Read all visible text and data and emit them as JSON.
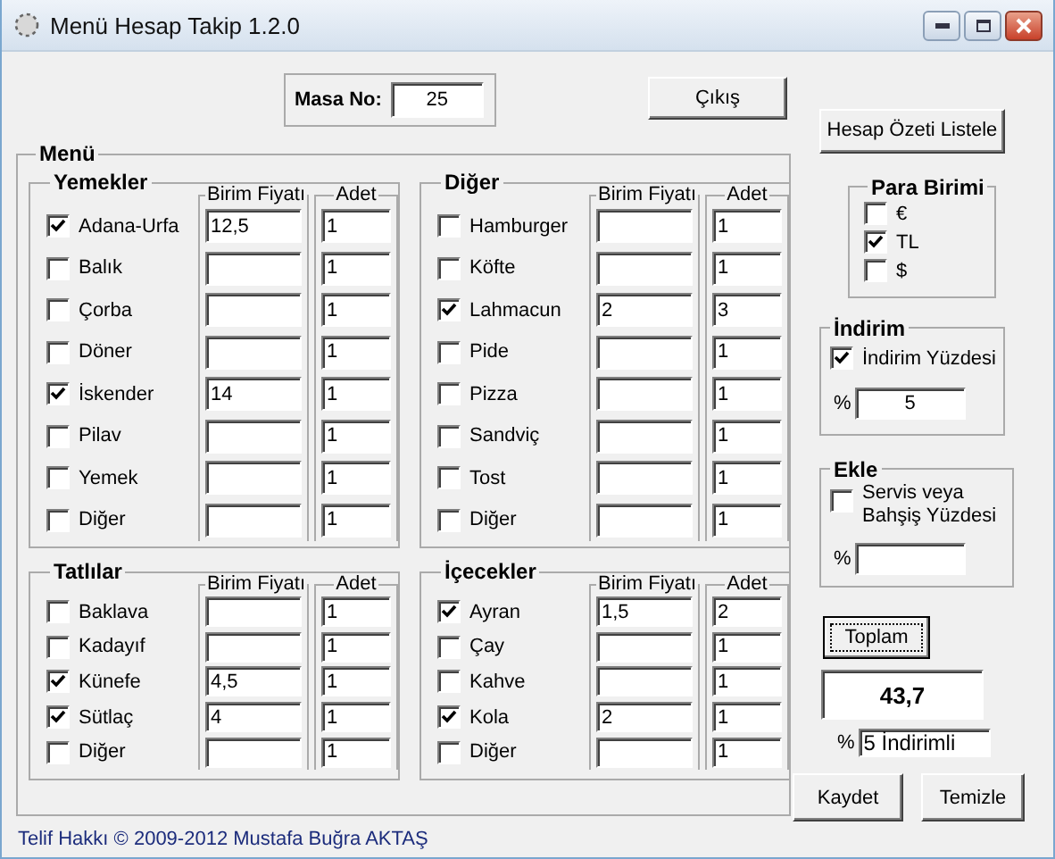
{
  "window": {
    "title": "Menü Hesap Takip 1.2.0"
  },
  "table_no": {
    "label": "Masa No:",
    "value": "25"
  },
  "exit_button": "Çıkış",
  "menu": {
    "title": "Menü",
    "groups": [
      {
        "title": "Yemekler",
        "price_header": "Birim Fiyatı",
        "qty_header": "Adet",
        "items": [
          {
            "label": "Adana-Urfa",
            "checked": true,
            "price": "12,5",
            "qty": "1"
          },
          {
            "label": "Balık",
            "checked": false,
            "qty": "1"
          },
          {
            "label": "Çorba",
            "checked": false,
            "qty": "1"
          },
          {
            "label": "Döner",
            "checked": false,
            "qty": "1"
          },
          {
            "label": "İskender",
            "checked": true,
            "price": "14",
            "qty": "1"
          },
          {
            "label": "Pilav",
            "checked": false,
            "qty": "1"
          },
          {
            "label": "Yemek",
            "checked": false,
            "qty": "1"
          },
          {
            "label": "Diğer",
            "checked": false,
            "qty": "1"
          }
        ]
      },
      {
        "title": "Diğer",
        "price_header": "Birim Fiyatı",
        "qty_header": "Adet",
        "items": [
          {
            "label": "Hamburger",
            "checked": false,
            "qty": "1"
          },
          {
            "label": "Köfte",
            "checked": false,
            "qty": "1"
          },
          {
            "label": "Lahmacun",
            "checked": true,
            "price": "2",
            "qty": "3"
          },
          {
            "label": "Pide",
            "checked": false,
            "qty": "1"
          },
          {
            "label": "Pizza",
            "checked": false,
            "qty": "1"
          },
          {
            "label": "Sandviç",
            "checked": false,
            "qty": "1"
          },
          {
            "label": "Tost",
            "checked": false,
            "qty": "1"
          },
          {
            "label": "Diğer",
            "checked": false,
            "qty": "1"
          }
        ]
      },
      {
        "title": "Tatlılar",
        "price_header": "Birim Fiyatı",
        "qty_header": "Adet",
        "items": [
          {
            "label": "Baklava",
            "checked": false,
            "qty": "1"
          },
          {
            "label": "Kadayıf",
            "checked": false,
            "qty": "1"
          },
          {
            "label": "Künefe",
            "checked": true,
            "price": "4,5",
            "qty": "1"
          },
          {
            "label": "Sütlaç",
            "checked": true,
            "price": "4",
            "qty": "1"
          },
          {
            "label": "Diğer",
            "checked": false,
            "qty": "1"
          }
        ]
      },
      {
        "title": "İçecekler",
        "price_header": "Birim Fiyatı",
        "qty_header": "Adet",
        "items": [
          {
            "label": "Ayran",
            "checked": true,
            "price": "1,5",
            "qty": "2"
          },
          {
            "label": "Çay",
            "checked": false,
            "qty": "1"
          },
          {
            "label": "Kahve",
            "checked": false,
            "qty": "1"
          },
          {
            "label": "Kola",
            "checked": true,
            "price": "2",
            "qty": "1"
          },
          {
            "label": "Diğer",
            "checked": false,
            "qty": "1"
          }
        ]
      }
    ]
  },
  "summary_button": "Hesap Özeti Listele",
  "currency": {
    "title": "Para Birimi",
    "options": [
      {
        "label": "€",
        "checked": false
      },
      {
        "label": "TL",
        "checked": true
      },
      {
        "label": "$",
        "checked": false
      }
    ]
  },
  "discount": {
    "title": "İndirim",
    "option": {
      "label": "İndirim Yüzdesi",
      "checked": true
    },
    "percent_sign": "%",
    "value": "5"
  },
  "extra": {
    "title": "Ekle",
    "option": {
      "label": "Servis veya Bahşiş Yüzdesi",
      "checked": false
    },
    "percent_sign": "%"
  },
  "total_button": "Toplam",
  "total": "43,7",
  "total_note": {
    "percent_sign": "%",
    "value": "5 İndirimli"
  },
  "save_button": "Kaydet",
  "clear_button": "Temizle",
  "footer": "Telif Hakkı © 2009-2012 Mustafa Buğra AKTAŞ"
}
